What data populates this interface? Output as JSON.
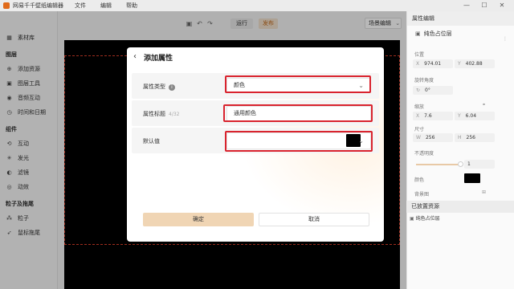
{
  "app": {
    "title": "网易千千壁纸编辑器"
  },
  "menu": [
    "文件",
    "编辑",
    "帮助"
  ],
  "window_controls": {
    "minimize": "—",
    "maximize": "☐",
    "close": "✕"
  },
  "sidebar": {
    "top_item": "素材库",
    "sections": [
      {
        "title": "图层",
        "items": [
          "添加资源",
          "图层工具",
          "音频互动",
          "时间和日期"
        ]
      },
      {
        "title": "组件",
        "items": [
          "互动",
          "发光",
          "滤镜",
          "动效"
        ]
      },
      {
        "title": "粒子及拖尾",
        "items": [
          "粒子",
          "鼠标拖尾"
        ]
      }
    ]
  },
  "toolbar": {
    "run": "运行",
    "publish": "发布",
    "scene_edit": "场景编辑"
  },
  "right_panel": {
    "title": "属性编辑",
    "layer_name": "纯色占位层",
    "position_label": "位置",
    "pos_x": "974.01",
    "pos_y": "402.88",
    "rotation_label": "旋转角度",
    "rotation": "0°",
    "scale_label": "缩放",
    "scale_x": "7.6",
    "scale_y": "6.04",
    "size_label": "尺寸",
    "width": "256",
    "height": "256",
    "opacity_label": "不透明度",
    "opacity": "1",
    "color_label": "颜色",
    "bg_label": "背景图",
    "resources_title": "已放置资源",
    "resource_item": "纯色占位层",
    "x_key": "X",
    "y_key": "Y",
    "w_key": "W",
    "h_key": "H"
  },
  "dialog": {
    "title": "添加属性",
    "type_label": "属性类型",
    "type_value": "颜色",
    "title_label": "属性标题",
    "title_counter": "4/32",
    "title_value": "通用颜色",
    "default_label": "默认值",
    "default_color": "#000000",
    "ok": "确定",
    "cancel": "取消"
  },
  "colors": {
    "accent": "#f0d5b4",
    "highlight": "#d9232e",
    "publish_text": "#c0691c"
  }
}
